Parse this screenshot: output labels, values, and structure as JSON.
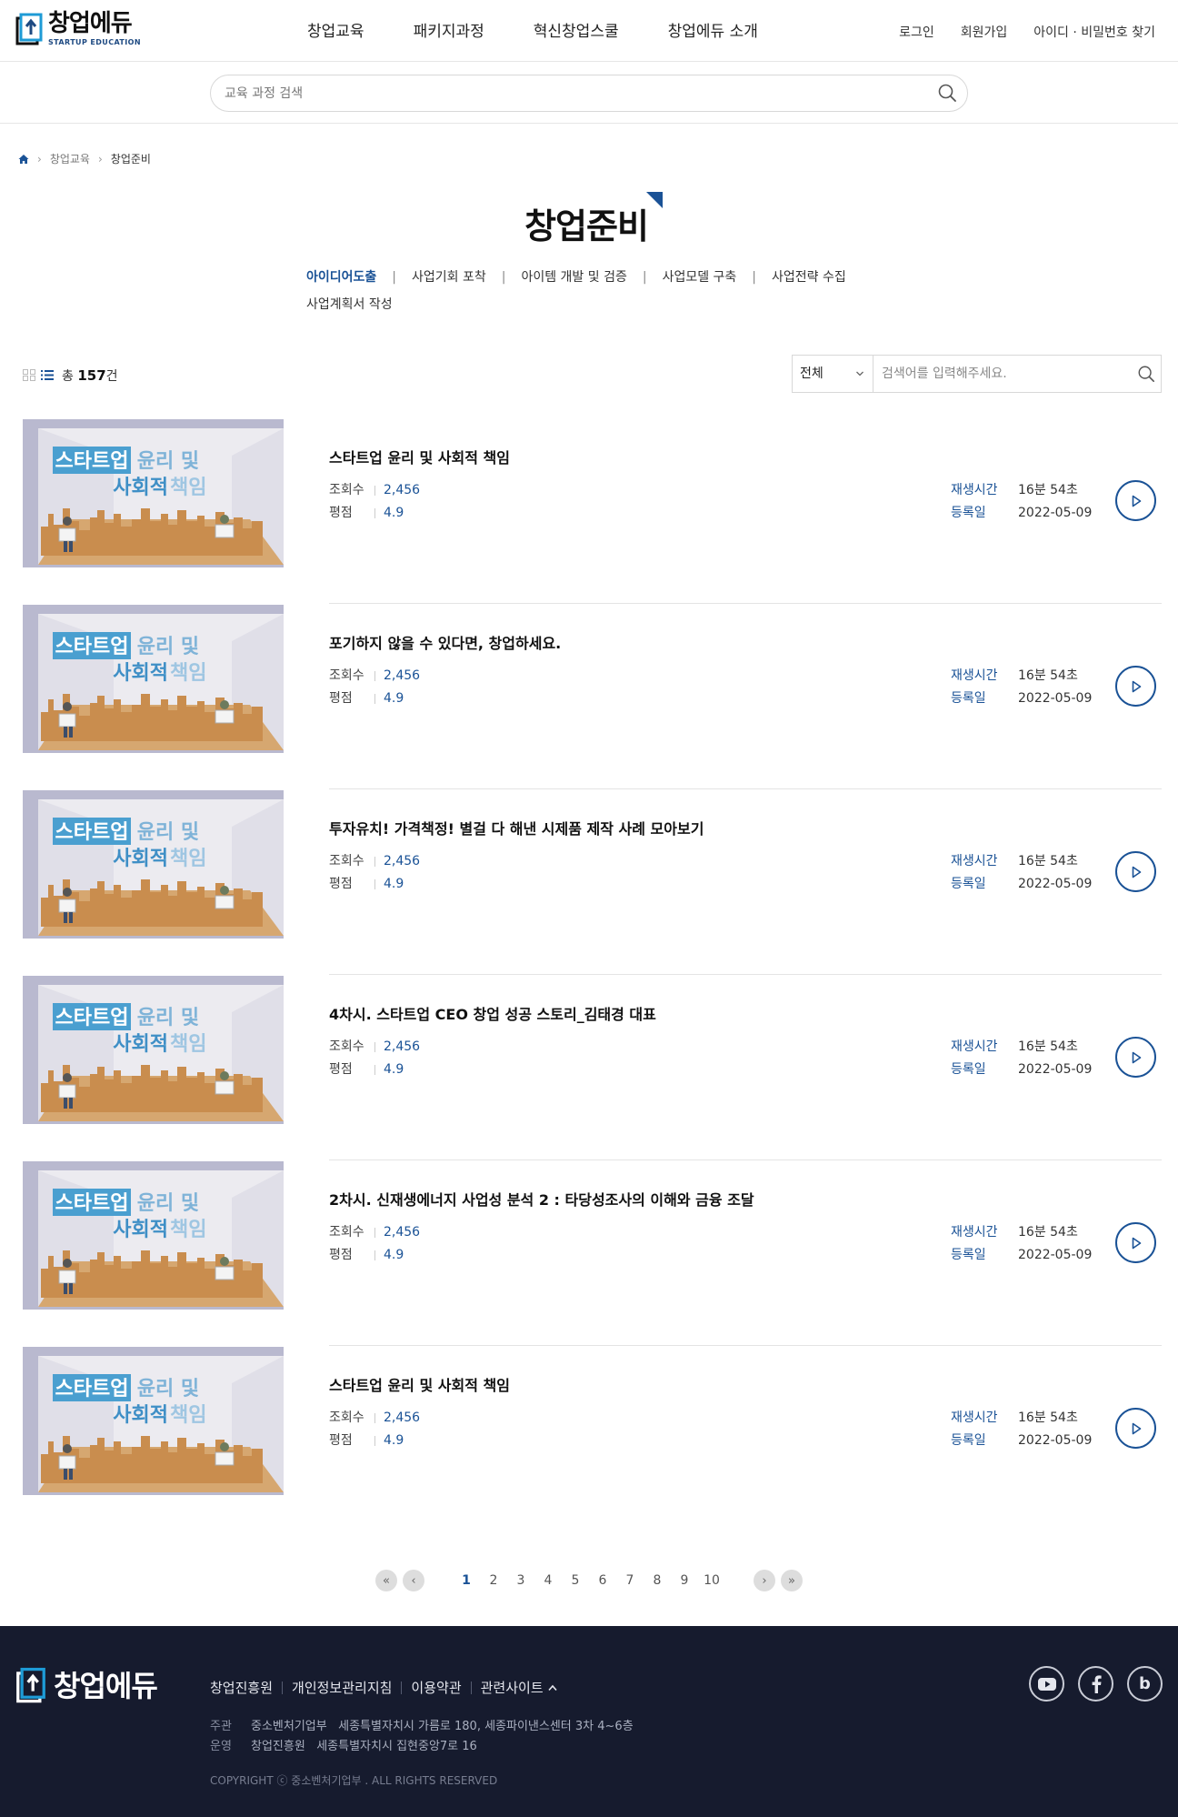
{
  "header": {
    "logo_title": "창업에듀",
    "logo_sub": "STARTUP EDUCATION",
    "gnb": [
      "창업교육",
      "패키지과정",
      "혁신창업스쿨",
      "창업에듀 소개"
    ],
    "util": [
      "로그인",
      "회원가입",
      "아이디 · 비밀번호 찾기"
    ]
  },
  "search": {
    "placeholder": "교육 과정 검색",
    "icon": "search-icon"
  },
  "breadcrumb": {
    "home_icon": "home-icon",
    "items": [
      "창업교육",
      "창업준비"
    ]
  },
  "page_title": "창업준비",
  "categories": [
    "아이디어도출",
    "사업기회 포착",
    "아이템 개발 및 검증",
    "사업모델 구축",
    "사업전략 수집",
    "사업계획서 작성"
  ],
  "active_category": "아이디어도출",
  "toolbar": {
    "total_prefix": "총",
    "total_count": "157",
    "total_suffix": "건",
    "filter_selected": "전체",
    "filter_placeholder": "검색어를 입력해주세요."
  },
  "labels": {
    "views": "조회수",
    "rating": "평점",
    "duration": "재생시간",
    "date": "등록일"
  },
  "thumbnail_text": {
    "line1a": "스타트업",
    "line1b": "윤리 및",
    "line2a": "사회적",
    "line2b": "책임"
  },
  "courses": [
    {
      "title": "스타트업 윤리 및 사회적 책임",
      "views": "2,456",
      "rating": "4.9",
      "duration": "16분 54초",
      "date": "2022-05-09"
    },
    {
      "title": "포기하지 않을 수 있다면, 창업하세요.",
      "views": "2,456",
      "rating": "4.9",
      "duration": "16분 54초",
      "date": "2022-05-09"
    },
    {
      "title": "투자유치! 가격책정! 별걸 다 해낸 시제품 제작 사례 모아보기",
      "views": "2,456",
      "rating": "4.9",
      "duration": "16분 54초",
      "date": "2022-05-09"
    },
    {
      "title": "4차시. 스타트업 CEO 창업 성공 스토리_김태경 대표",
      "views": "2,456",
      "rating": "4.9",
      "duration": "16분 54초",
      "date": "2022-05-09"
    },
    {
      "title": "2차시. 신재생에너지 사업성 분석 2 : 타당성조사의 이해와 금융 조달",
      "views": "2,456",
      "rating": "4.9",
      "duration": "16분 54초",
      "date": "2022-05-09"
    },
    {
      "title": "스타트업 윤리 및 사회적 책임",
      "views": "2,456",
      "rating": "4.9",
      "duration": "16분 54초",
      "date": "2022-05-09"
    }
  ],
  "pagination": {
    "first": "«",
    "prev": "‹",
    "next": "›",
    "last": "»",
    "pages": [
      "1",
      "2",
      "3",
      "4",
      "5",
      "6",
      "7",
      "8",
      "9",
      "10"
    ],
    "current": "1"
  },
  "footer": {
    "logo_title": "창업에듀",
    "links": [
      "창업진흥원",
      "개인정보관리지침",
      "이용약관",
      "관련사이트"
    ],
    "info": [
      {
        "key": "주관",
        "org": "중소벤처기업부",
        "addr": "세종특별자치시 가름로 180, 세종파이낸스센터 3차 4~6층"
      },
      {
        "key": "운영",
        "org": "창업진흥원",
        "addr": "세종특별자치시 집현중앙7로 16"
      }
    ],
    "copyright": "COPYRIGHT ⓒ 중소벤처기업부 . ALL RIGHTS RESERVED",
    "sns": [
      "youtube-icon",
      "facebook-icon",
      "blog-icon"
    ],
    "blog_letter": "b"
  },
  "colors": {
    "accent": "#1a5296",
    "footer_bg": "#161b2e",
    "thumb_bg": "#b9b9cf"
  }
}
